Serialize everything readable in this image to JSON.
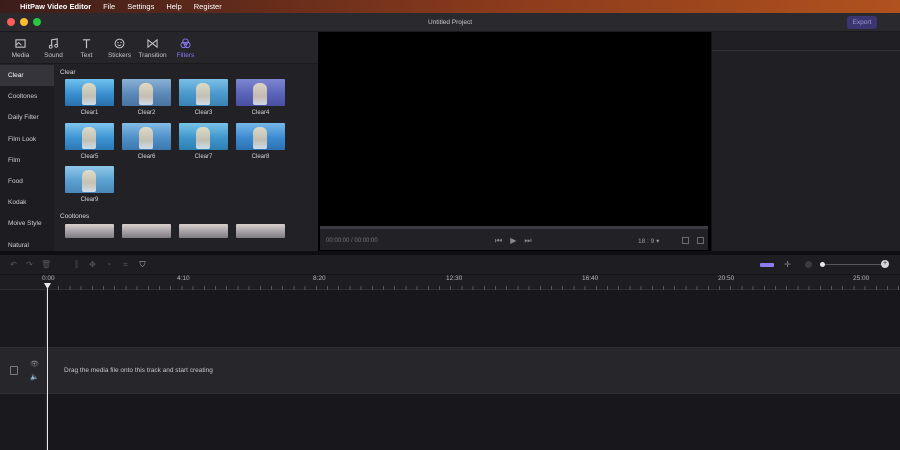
{
  "menubar": {
    "app_name": "HitPaw Video Editor",
    "items": [
      "File",
      "Settings",
      "Help",
      "Register"
    ]
  },
  "window": {
    "title": "Untitled Project",
    "export_label": "Export"
  },
  "tabs": [
    {
      "label": "Media",
      "icon": "media-icon"
    },
    {
      "label": "Sound",
      "icon": "music-note-icon"
    },
    {
      "label": "Text",
      "icon": "text-icon"
    },
    {
      "label": "Stickers",
      "icon": "smiley-icon"
    },
    {
      "label": "Transition",
      "icon": "bowtie-icon"
    },
    {
      "label": "Filters",
      "icon": "filters-icon",
      "active": true
    }
  ],
  "categories": [
    "Clear",
    "Cooltones",
    "Daily Filter",
    "Film Look",
    "Film",
    "Food",
    "Kodak",
    "Moive Style",
    "Natural"
  ],
  "filters": {
    "section_clear": "Clear",
    "clear_items": [
      "Clear1",
      "Clear2",
      "Clear3",
      "Clear4",
      "Clear5",
      "Clear6",
      "Clear7",
      "Clear8",
      "Clear9"
    ],
    "section_cooltones": "Cooltones"
  },
  "preview": {
    "time": "00:00:00 / 00:00:00",
    "aspect_ratio": "18 : 9"
  },
  "timeline": {
    "ruler_ticks": [
      "0:00",
      "4:10",
      "8:20",
      "12:30",
      "16:40",
      "20:50",
      "25:00"
    ],
    "drop_hint": "Drag the media file onto this track and start creating"
  },
  "colors": {
    "accent": "#8b7cf4",
    "export_bg": "#3c3670"
  }
}
